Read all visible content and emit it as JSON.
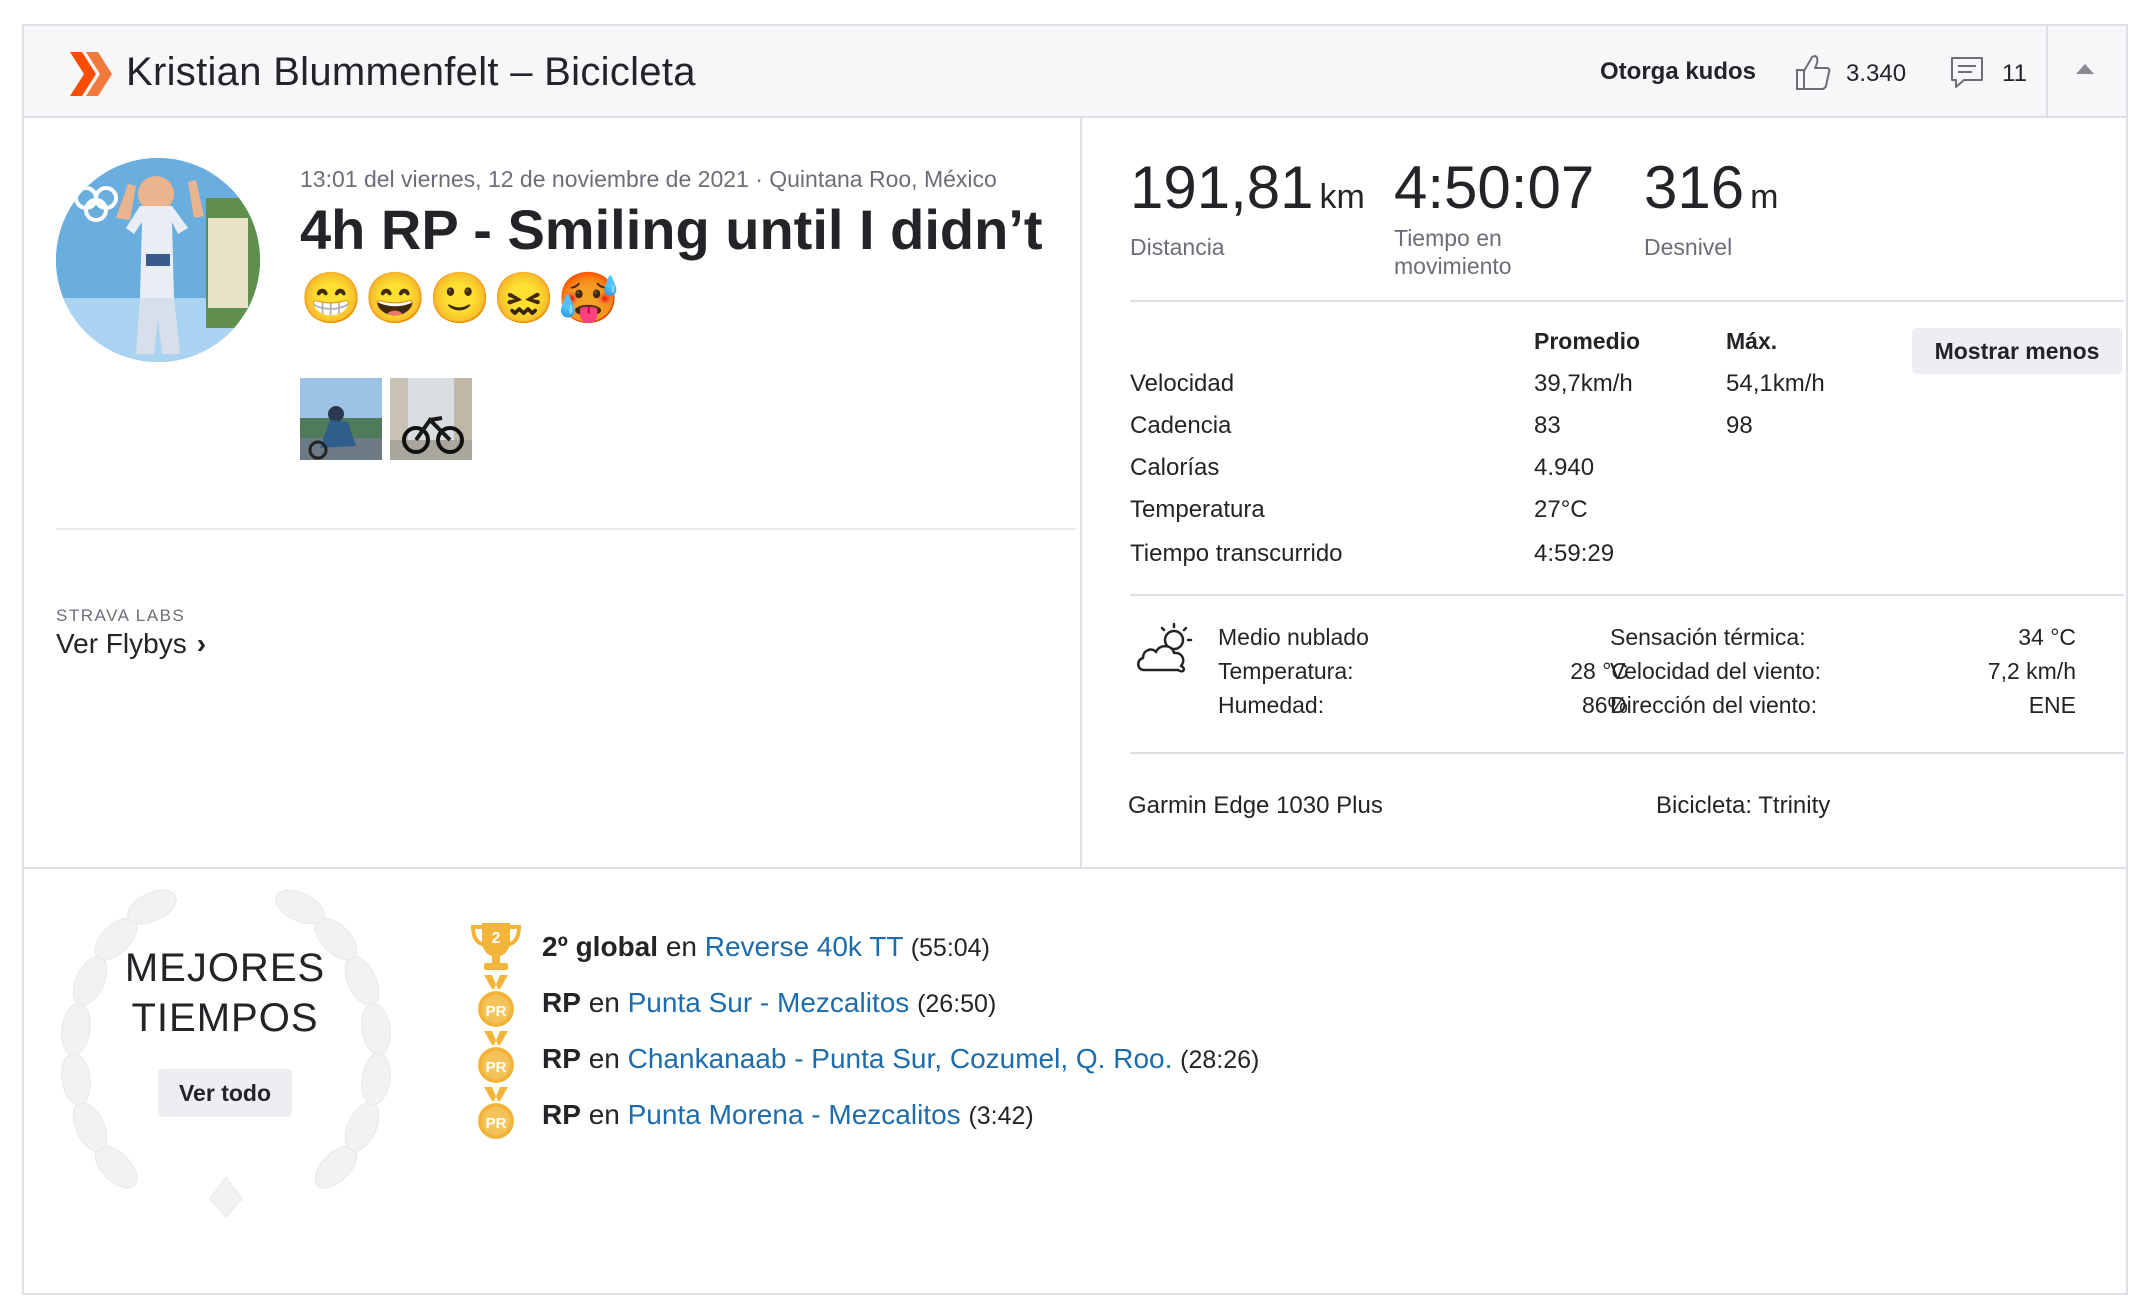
{
  "header": {
    "title": "Kristian Blummenfelt – Bicicleta",
    "give_kudos_label": "Otorga kudos",
    "kudos_count": "3.340",
    "comment_count": "11"
  },
  "activity": {
    "timestamp": "13:01 del viernes, 12 de noviembre de 2021 · Quintana Roo, México",
    "title": "4h RP - Smiling until I didn’t",
    "emojis": "😁😄🙂😖🥵",
    "labs_label": "STRAVA LABS",
    "flybys_label": "Ver Flybys"
  },
  "stats": {
    "distance_value": "191,81",
    "distance_unit": "km",
    "distance_label": "Distancia",
    "moving_time_value": "4:50:07",
    "moving_time_label": "Tiempo en movimiento",
    "elevation_value": "316",
    "elevation_unit": "m",
    "elevation_label": "Desnivel"
  },
  "more_stats": {
    "avg_header": "Promedio",
    "max_header": "Máx.",
    "show_less_label": "Mostrar menos",
    "rows": [
      {
        "label": "Velocidad",
        "avg": "39,7km/h",
        "max": "54,1km/h"
      },
      {
        "label": "Cadencia",
        "avg": "83",
        "max": "98"
      },
      {
        "label": "Calorías",
        "avg": "4.940",
        "max": ""
      },
      {
        "label": "Temperatura",
        "avg": "27°C",
        "max": ""
      },
      {
        "label": "Tiempo transcurrido",
        "avg": "4:59:29",
        "max": ""
      }
    ]
  },
  "weather": {
    "condition": "Medio nublado",
    "temp_label": "Temperatura:",
    "temp_value": "28 °C",
    "humidity_label": "Humedad:",
    "humidity_value": "86%",
    "feels_label": "Sensación térmica:",
    "feels_value": "34 °C",
    "wind_speed_label": "Velocidad del viento:",
    "wind_speed_value": "7,2 km/h",
    "wind_dir_label": "Dirección del viento:",
    "wind_dir_value": "ENE"
  },
  "gear": {
    "device": "Garmin Edge 1030 Plus",
    "bike": "Bicicleta: Ttrinity"
  },
  "best_efforts": {
    "title_line1": "MEJORES",
    "title_line2": "TIEMPOS",
    "see_all_label": "Ver todo",
    "items": [
      {
        "rank": "2º global",
        "connector": "en",
        "segment": "Reverse 40k TT",
        "time": "(55:04)",
        "icon": "trophy-icon"
      },
      {
        "rank": "RP",
        "connector": "en",
        "segment": "Punta Sur - Mezcalitos",
        "time": "(26:50)",
        "icon": "pr-medal-icon"
      },
      {
        "rank": "RP",
        "connector": "en",
        "segment": "Chankanaab - Punta Sur, Cozumel, Q. Roo.",
        "time": "(28:26)",
        "icon": "pr-medal-icon"
      },
      {
        "rank": "RP",
        "connector": "en",
        "segment": "Punta Morena - Mezcalitos",
        "time": "(3:42)",
        "icon": "pr-medal-icon"
      }
    ]
  },
  "colors": {
    "brand_orange": "#fc4c02",
    "link_blue": "#1d6cab",
    "gold": "#f2b53a",
    "text_dark": "#242428",
    "text_muted": "#6d6d78"
  }
}
